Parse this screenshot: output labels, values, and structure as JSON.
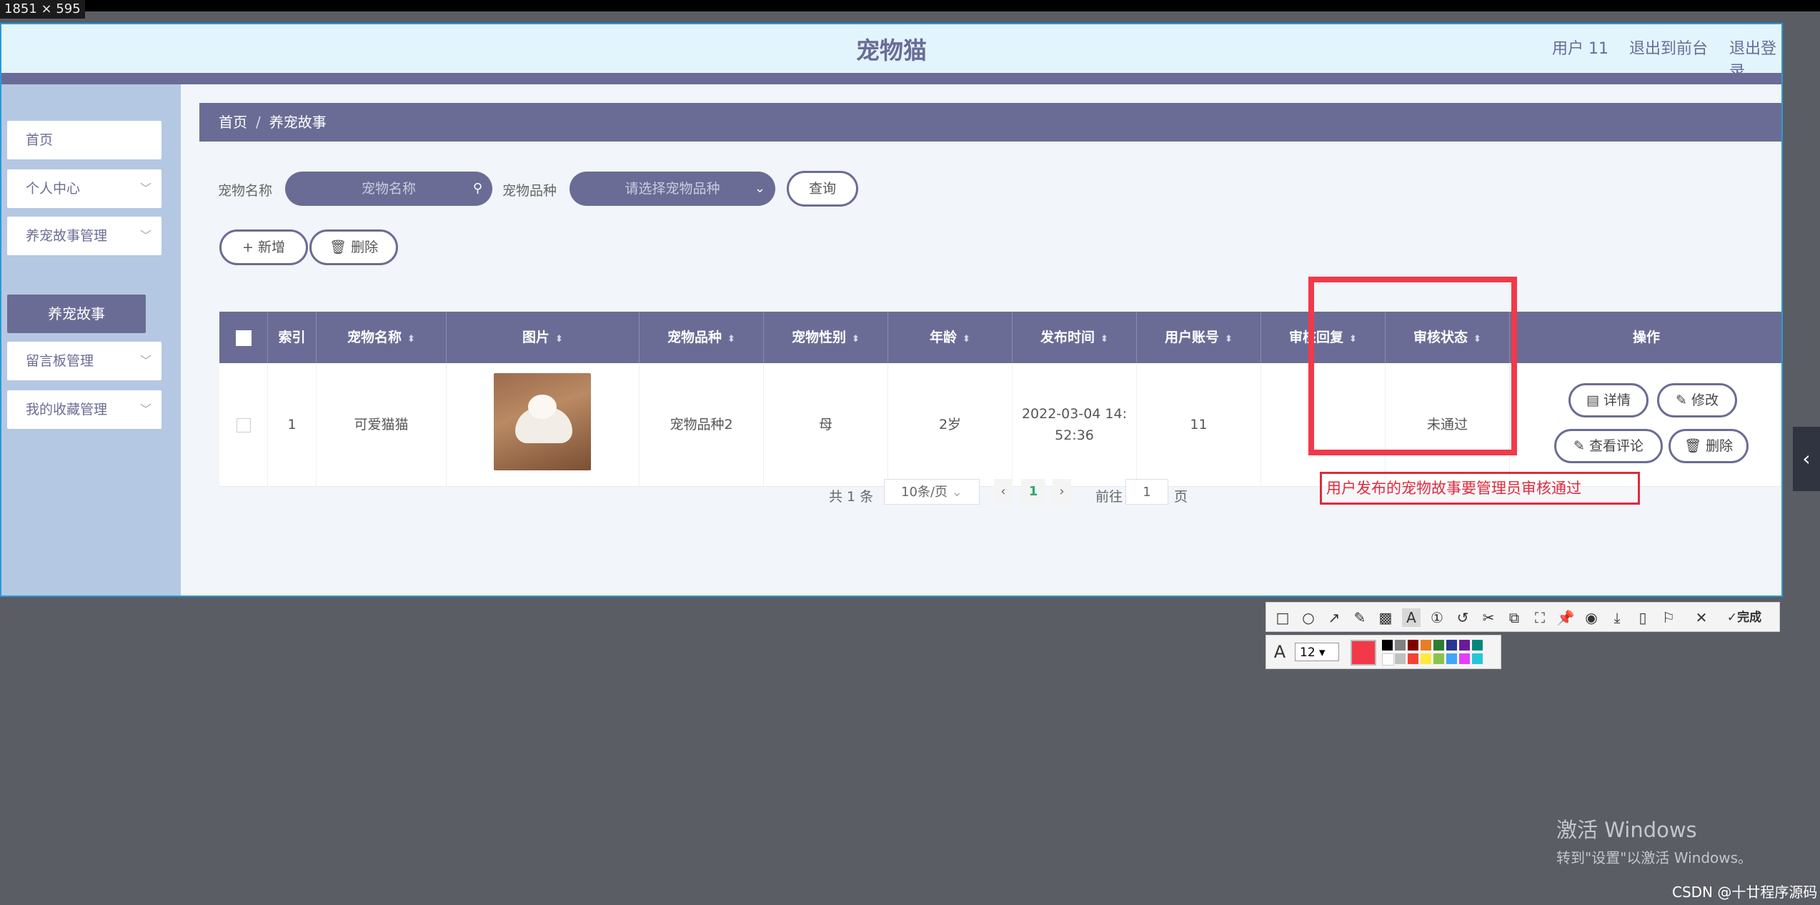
{
  "size_tag": "1851 × 595",
  "header": {
    "title": "宠物猫",
    "user": "用户 11",
    "to_front": "退出到前台",
    "logout": "退出登录"
  },
  "sidebar": {
    "items": [
      {
        "label": "首页"
      },
      {
        "label": "个人中心",
        "chevron": "﹀"
      },
      {
        "label": "养宠故事管理",
        "chevron": "﹀"
      },
      {
        "label": "留言板管理",
        "chevron": "﹀"
      },
      {
        "label": "我的收藏管理",
        "chevron": "﹀"
      }
    ],
    "active_sub": "养宠故事"
  },
  "breadcrumb": {
    "home": "首页",
    "sep": "/",
    "current": "养宠故事"
  },
  "search": {
    "pet_name_label": "宠物名称",
    "pet_name_placeholder": "宠物名称",
    "pet_breed_label": "宠物品种",
    "pet_breed_placeholder": "请选择宠物品种",
    "query_button": "查询"
  },
  "actions": {
    "add": "新增",
    "delete": "删除",
    "add_icon": "+",
    "delete_icon": "🗑"
  },
  "table": {
    "headers": [
      "索引",
      "宠物名称",
      "图片",
      "宠物品种",
      "宠物性别",
      "年龄",
      "发布时间",
      "用户账号",
      "审核回复",
      "审核状态",
      "操作"
    ],
    "sort_icon": "⬍",
    "rows": [
      {
        "index": "1",
        "pet_name": "可爱猫猫",
        "breed": "宠物品种2",
        "gender": "母",
        "age": "2岁",
        "publish_time_1": "2022-03-04 14:",
        "publish_time_2": "52:36",
        "account": "11",
        "reply": "",
        "status": "未通过"
      }
    ],
    "row_actions": {
      "detail": "详情",
      "edit": "修改",
      "comments": "查看评论",
      "delete": "删除"
    }
  },
  "pager": {
    "total": "共 1 条",
    "page_size": "10条/页",
    "current_page": "1",
    "goto": "前往",
    "goto_value": "1",
    "page_unit": "页"
  },
  "annotation": {
    "text": "用户发布的宠物故事要管理员审核通过"
  },
  "toolbar": {
    "done": "完成",
    "font_size": "12"
  },
  "watermark": {
    "line1": "激活 Windows",
    "line2": "转到\"设置\"以激活 Windows。"
  },
  "csdn": "CSDN @十廿程序源码",
  "colors": {
    "primary": "#6b6c95",
    "header_bg": "#e2f4fc",
    "sidebar_bg": "#b4c8e3",
    "annotation_red": "#f2394a"
  }
}
